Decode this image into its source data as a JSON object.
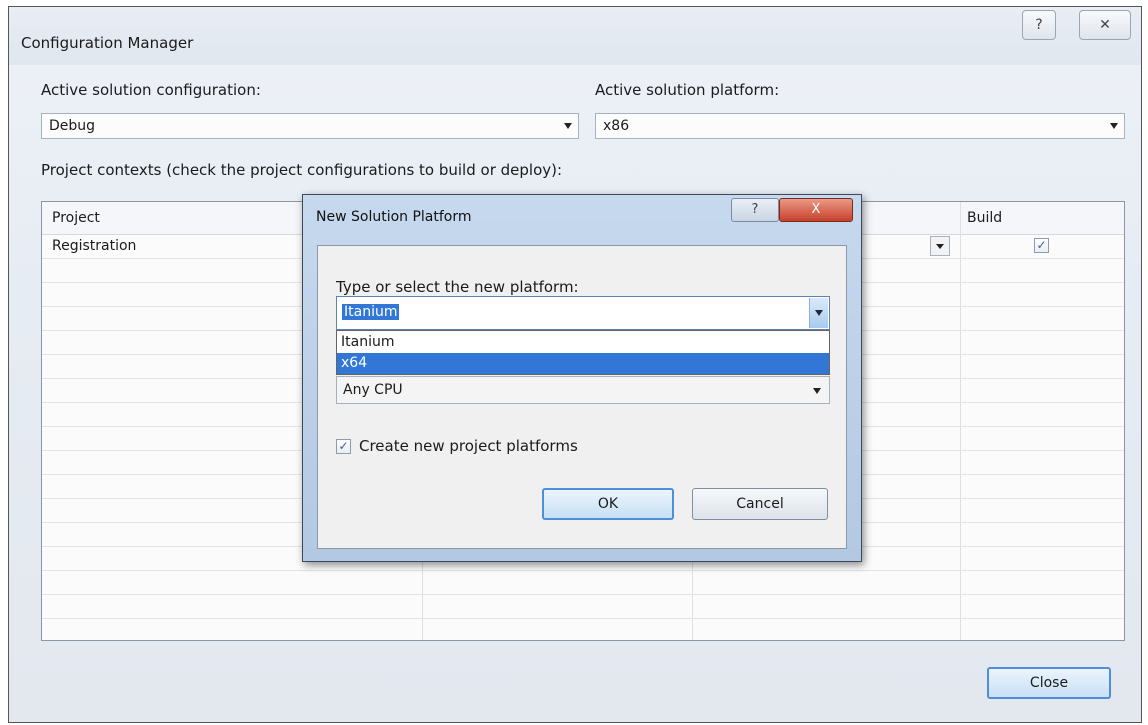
{
  "config_manager": {
    "title": "Configuration Manager",
    "help_glyph": "?",
    "close_glyph": "✕",
    "active_config_label": "Active solution configuration:",
    "active_config_value": "Debug",
    "active_platform_label": "Active solution platform:",
    "active_platform_value": "x86",
    "contexts_label": "Project contexts (check the project configurations to build or deploy):",
    "columns": {
      "project": "Project",
      "build": "Build"
    },
    "rows": [
      {
        "project": "Registration",
        "build_checked": true
      }
    ],
    "close_button": "Close"
  },
  "new_platform_dialog": {
    "title": "New Solution Platform",
    "help_glyph": "?",
    "close_glyph": "X",
    "type_label": "Type or select the new platform:",
    "platform_value": "Itanium",
    "options": [
      "Itanium",
      "x64"
    ],
    "selected_option": "x64",
    "copy_from_value": "Any CPU",
    "create_checkbox_label": "Create new project platforms",
    "create_checked": true,
    "ok_button": "OK",
    "cancel_button": "Cancel"
  }
}
